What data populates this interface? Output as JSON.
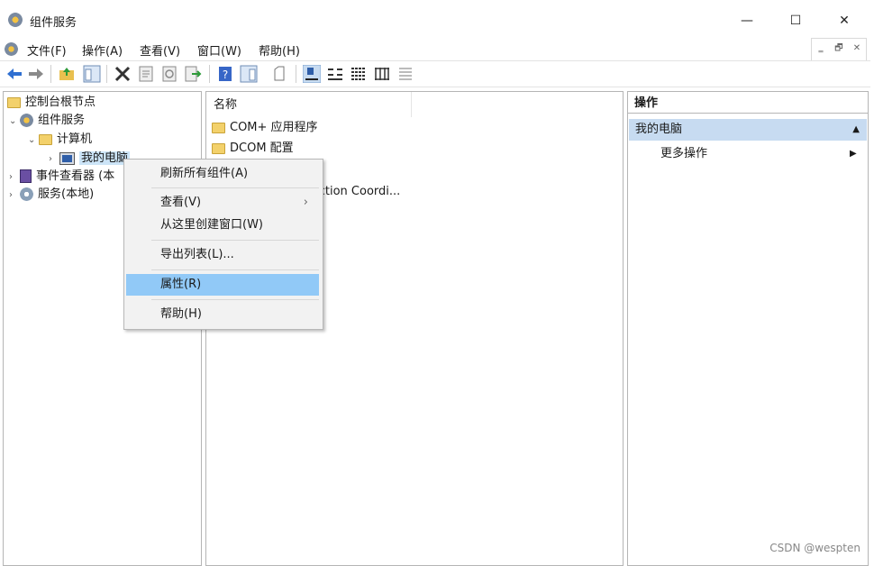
{
  "window": {
    "title": "组件服务",
    "minimize": "—",
    "maximize": "☐",
    "close": "✕"
  },
  "menubar": {
    "items": [
      "文件(F)",
      "操作(A)",
      "查看(V)",
      "窗口(W)",
      "帮助(H)"
    ],
    "mdi": [
      "‗",
      "🗗",
      "✕"
    ]
  },
  "toolbar": {
    "icons": [
      "back-icon",
      "forward-icon",
      "up-folder-icon",
      "show-hide-tree-icon",
      "delete-icon",
      "properties-icon",
      "refresh-icon",
      "export-icon",
      "help-icon",
      "action-pane-icon",
      "new-window-icon",
      "large-icons-view-icon",
      "small-icons-view-icon",
      "list-view-icon",
      "detail-view-icon",
      "status-view-icon"
    ],
    "colors": {
      "back": "#2f6fd1",
      "forward": "#2f6fd1",
      "help": "#3766c7"
    }
  },
  "tree": {
    "root": "控制台根节点",
    "component_services": "组件服务",
    "computers": "计算机",
    "my_computer": "我的电脑",
    "event_viewer": "事件查看器 (本",
    "services": "服务(本地)"
  },
  "list": {
    "header": "名称",
    "rows": [
      "COM+ 应用程序",
      "DCOM 配置",
      "saction Coordi..."
    ]
  },
  "actions": {
    "header": "操作",
    "section": "我的电脑",
    "more": "更多操作"
  },
  "context_menu": {
    "refresh_all": "刷新所有组件(A)",
    "view": "查看(V)",
    "new_window": "从这里创建窗口(W)",
    "export_list": "导出列表(L)...",
    "properties": "属性(R)",
    "help": "帮助(H)"
  },
  "watermark": "CSDN @wespten",
  "colors": {
    "selection": "#91c9f7",
    "action_section": "#c7dbf1",
    "folder": "#f3d16b"
  }
}
